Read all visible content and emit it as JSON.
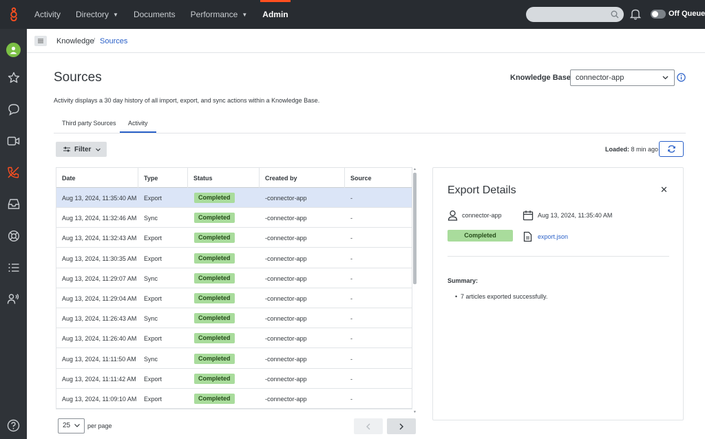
{
  "topnav": {
    "items": [
      {
        "label": "Activity"
      },
      {
        "label": "Directory",
        "has_caret": true
      },
      {
        "label": "Documents"
      },
      {
        "label": "Performance",
        "has_caret": true
      },
      {
        "label": "Admin",
        "active": true
      }
    ],
    "queue_label": "Off Queue"
  },
  "sidebar": {
    "icons": [
      "star-icon",
      "chat-icon",
      "video-icon",
      "phone-icon",
      "inbox-icon",
      "support-icon",
      "list-icon",
      "people-icon",
      "help-icon"
    ]
  },
  "breadcrumb": {
    "knowledge": "Knowledge",
    "separator": "/",
    "sources": "Sources"
  },
  "page": {
    "title": "Sources",
    "kb_label": "Knowledge Base",
    "kb_value": "connector-app",
    "description": "Activity displays a 30 day history of all import, export, and sync actions within a Knowledge Base.",
    "tabs": [
      {
        "label": "Third party Sources"
      },
      {
        "label": "Activity",
        "active": true
      }
    ],
    "filter_label": "Filter",
    "loaded_label": "Loaded:",
    "loaded_value": "8 min ago"
  },
  "table": {
    "headers": [
      "Date",
      "Type",
      "Status",
      "Created by",
      "Source"
    ],
    "rows": [
      {
        "date": "Aug 13, 2024, 11:35:40 AM",
        "type": "Export",
        "status": "Completed",
        "created_by": "-connector-app",
        "source": "-"
      },
      {
        "date": "Aug 13, 2024, 11:32:46 AM",
        "type": "Sync",
        "status": "Completed",
        "created_by": "-connector-app",
        "source": "-"
      },
      {
        "date": "Aug 13, 2024, 11:32:43 AM",
        "type": "Export",
        "status": "Completed",
        "created_by": "-connector-app",
        "source": "-"
      },
      {
        "date": "Aug 13, 2024, 11:30:35 AM",
        "type": "Export",
        "status": "Completed",
        "created_by": "-connector-app",
        "source": "-"
      },
      {
        "date": "Aug 13, 2024, 11:29:07 AM",
        "type": "Sync",
        "status": "Completed",
        "created_by": "-connector-app",
        "source": "-"
      },
      {
        "date": "Aug 13, 2024, 11:29:04 AM",
        "type": "Export",
        "status": "Completed",
        "created_by": "-connector-app",
        "source": "-"
      },
      {
        "date": "Aug 13, 2024, 11:26:43 AM",
        "type": "Sync",
        "status": "Completed",
        "created_by": "-connector-app",
        "source": "-"
      },
      {
        "date": "Aug 13, 2024, 11:26:40 AM",
        "type": "Export",
        "status": "Completed",
        "created_by": "-connector-app",
        "source": "-"
      },
      {
        "date": "Aug 13, 2024, 11:11:50 AM",
        "type": "Sync",
        "status": "Completed",
        "created_by": "-connector-app",
        "source": "-"
      },
      {
        "date": "Aug 13, 2024, 11:11:42 AM",
        "type": "Export",
        "status": "Completed",
        "created_by": "-connector-app",
        "source": "-"
      },
      {
        "date": "Aug 13, 2024, 11:09:10 AM",
        "type": "Export",
        "status": "Completed",
        "created_by": "-connector-app",
        "source": "-"
      }
    ],
    "selected_row": 0
  },
  "pagination": {
    "page_size": "25",
    "per_page_label": "per page"
  },
  "details": {
    "title": "Export Details",
    "user": "connector-app",
    "date": "Aug 13, 2024, 11:35:40 AM",
    "status": "Completed",
    "file": "export.json",
    "summary_label": "Summary:",
    "summary_items": [
      "7 articles exported successfully."
    ]
  },
  "colors": {
    "topbar": "#282c31",
    "sidebar": "#2f3338",
    "accent": "#2a60c8",
    "brand": "#ff4f1f",
    "status_completed": "#a9dc9c",
    "selected_row": "#dbe5f7"
  }
}
